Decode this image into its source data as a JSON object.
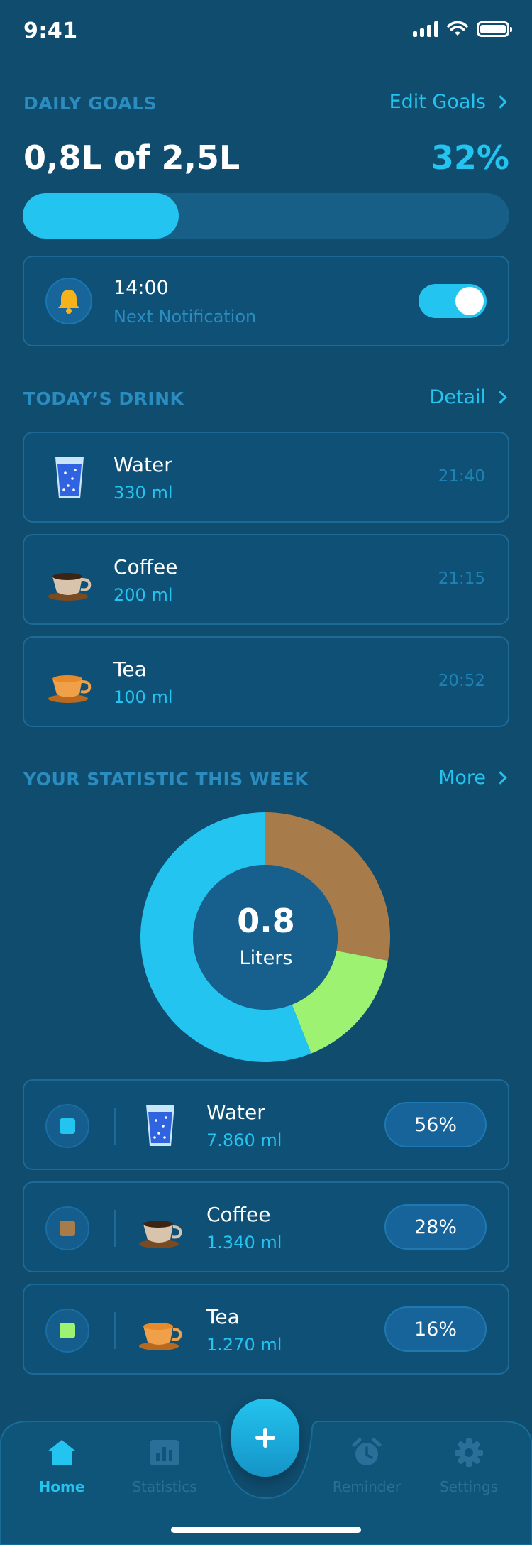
{
  "status_bar": {
    "time": "9:41"
  },
  "daily_goals": {
    "title": "DAILY GOALS",
    "edit_link": "Edit Goals",
    "amount_text": "0,8L of 2,5L",
    "percent_text": "32%",
    "progress_fraction": 0.32
  },
  "notification": {
    "time": "14:00",
    "label": "Next Notification",
    "enabled": true
  },
  "todays_drink": {
    "title": "TODAY’S DRINK",
    "detail_link": "Detail",
    "items": [
      {
        "name": "Water",
        "amount": "330 ml",
        "time": "21:40",
        "icon": "water-glass-icon"
      },
      {
        "name": "Coffee",
        "amount": "200 ml",
        "time": "21:15",
        "icon": "coffee-cup-icon"
      },
      {
        "name": "Tea",
        "amount": "100 ml",
        "time": "20:52",
        "icon": "tea-cup-icon"
      }
    ]
  },
  "statistic": {
    "title": "YOUR STATISTIC THIS WEEK",
    "more_link": "More",
    "center_value": "0.8",
    "center_unit": "Liters",
    "items": [
      {
        "name": "Water",
        "amount": "7.860 ml",
        "percent": "56%",
        "color": "#23c4ef",
        "icon": "water-glass-icon"
      },
      {
        "name": "Coffee",
        "amount": "1.340 ml",
        "percent": "28%",
        "color": "#a87b4a",
        "icon": "coffee-cup-icon"
      },
      {
        "name": "Tea",
        "amount": "1.270 ml",
        "percent": "16%",
        "color": "#9ef271",
        "icon": "tea-cup-icon"
      }
    ]
  },
  "chart_data": {
    "type": "pie",
    "categories": [
      "Water",
      "Coffee",
      "Tea"
    ],
    "values": [
      56,
      28,
      16
    ],
    "colors": [
      "#23c4ef",
      "#a87b4a",
      "#9ef271"
    ]
  },
  "nav": {
    "items": [
      {
        "label": "Home",
        "icon": "home-icon",
        "active": true
      },
      {
        "label": "Statistics",
        "icon": "bar-chart-icon",
        "active": false
      },
      {
        "label": "Reminder",
        "icon": "alarm-clock-icon",
        "active": false
      },
      {
        "label": "Settings",
        "icon": "gear-icon",
        "active": false
      }
    ],
    "add_icon": "plus-icon"
  },
  "colors": {
    "background": "#0f4c6e",
    "accent": "#23c4ef",
    "muted": "#2b8cc0"
  }
}
